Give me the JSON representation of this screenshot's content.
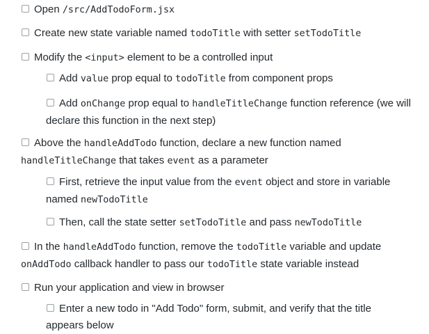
{
  "tasks": [
    {
      "segments": [
        {
          "t": "Open "
        },
        {
          "t": "/src/AddTodoForm.jsx",
          "code": true
        }
      ]
    },
    {
      "segments": [
        {
          "t": "Create new state variable named "
        },
        {
          "t": "todoTitle",
          "code": true
        },
        {
          "t": " with setter "
        },
        {
          "t": "setTodoTitle",
          "code": true
        }
      ]
    },
    {
      "segments": [
        {
          "t": "Modify the "
        },
        {
          "t": "<input>",
          "code": true
        },
        {
          "t": " element to be a controlled input"
        }
      ]
    },
    {
      "segments": [
        {
          "t": "Add "
        },
        {
          "t": "value",
          "code": true
        },
        {
          "t": " prop equal to "
        },
        {
          "t": "todoTitle",
          "code": true
        },
        {
          "t": " from component props"
        }
      ]
    },
    {
      "segments": [
        {
          "t": "Add "
        },
        {
          "t": "onChange",
          "code": true
        },
        {
          "t": " prop equal to "
        },
        {
          "t": "handleTitleChange",
          "code": true
        },
        {
          "t": " function reference (we will declare this function in the next step)"
        }
      ]
    },
    {
      "segments": [
        {
          "t": "Above the "
        },
        {
          "t": "handleAddTodo",
          "code": true
        },
        {
          "t": " function, declare a new function named "
        },
        {
          "t": "handleTitleChange",
          "code": true
        },
        {
          "t": " that takes "
        },
        {
          "t": "event",
          "code": true
        },
        {
          "t": " as a parameter"
        }
      ]
    },
    {
      "segments": [
        {
          "t": "First, retrieve the input value from the "
        },
        {
          "t": "event",
          "code": true
        },
        {
          "t": " object and store in variable named "
        },
        {
          "t": "newTodoTitle",
          "code": true
        }
      ]
    },
    {
      "segments": [
        {
          "t": "Then, call the state setter "
        },
        {
          "t": "setTodoTitle",
          "code": true
        },
        {
          "t": " and pass "
        },
        {
          "t": "newTodoTitle",
          "code": true
        }
      ]
    },
    {
      "segments": [
        {
          "t": "In the "
        },
        {
          "t": "handleAddTodo",
          "code": true
        },
        {
          "t": " function, remove the "
        },
        {
          "t": "todoTitle",
          "code": true
        },
        {
          "t": " variable and update "
        },
        {
          "t": "onAddTodo",
          "code": true
        },
        {
          "t": " callback handler to pass our "
        },
        {
          "t": "todoTitle",
          "code": true
        },
        {
          "t": " state variable instead"
        }
      ]
    },
    {
      "segments": [
        {
          "t": "Run your application and view in browser"
        }
      ]
    },
    {
      "segments": [
        {
          "t": "Enter a new todo in \"Add Todo\" form, submit, and verify that the title appears below"
        }
      ]
    }
  ]
}
